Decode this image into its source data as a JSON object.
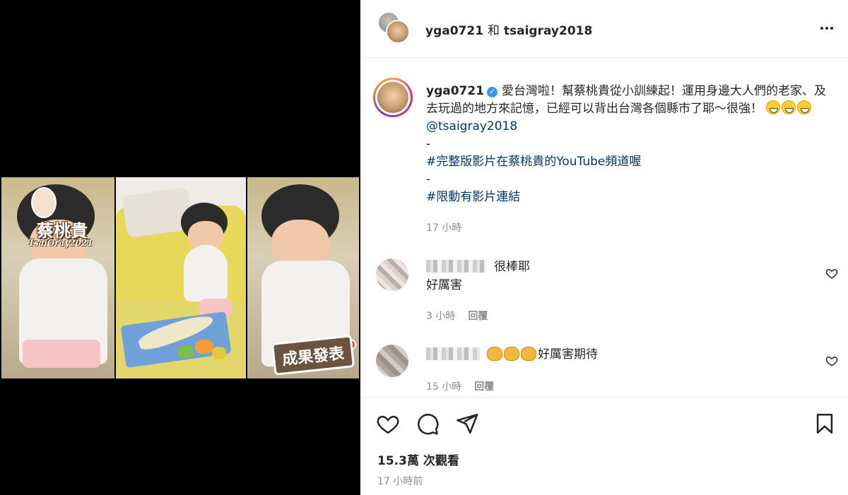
{
  "media": {
    "logo_text": "蔡桃貴",
    "logo_sub": "TsaiGray2021",
    "result_badge": "成果發表"
  },
  "header": {
    "user1": "yga0721",
    "and": "和",
    "user2": "tsaigray2018"
  },
  "caption": {
    "username": "yga0721",
    "verified_mark": "✓",
    "text_line": "愛台灣啦！幫蔡桃貴從小訓練起！運用身邊大人們的老家、及去玩過的地方來記憶，已經可以背出台灣各個縣市了耶～很強！",
    "mention": "@tsaigray2018",
    "dash1": "-",
    "hashtag1": "#完整版影片在蔡桃貴的YouTube頻道喔",
    "dash2": "-",
    "hashtag2": "#限動有影片連結",
    "time": "17 小時"
  },
  "comments": [
    {
      "text": "很棒耶",
      "text2": "好厲害",
      "time": "3 小時",
      "reply": "回覆"
    },
    {
      "text": "好厲害期待",
      "time": "15 小時",
      "reply": "回覆"
    }
  ],
  "stats": {
    "views_number": "15.3萬",
    "views_unit": "次觀看",
    "posted": "17 小時前"
  },
  "icons": {
    "like": "heart-icon",
    "comment": "comment-icon",
    "share": "paper-plane-icon",
    "save": "bookmark-icon",
    "more": "more-icon",
    "verified": "verified-badge-icon",
    "accent_link": "#00376b",
    "verified_color": "#3897f0"
  }
}
